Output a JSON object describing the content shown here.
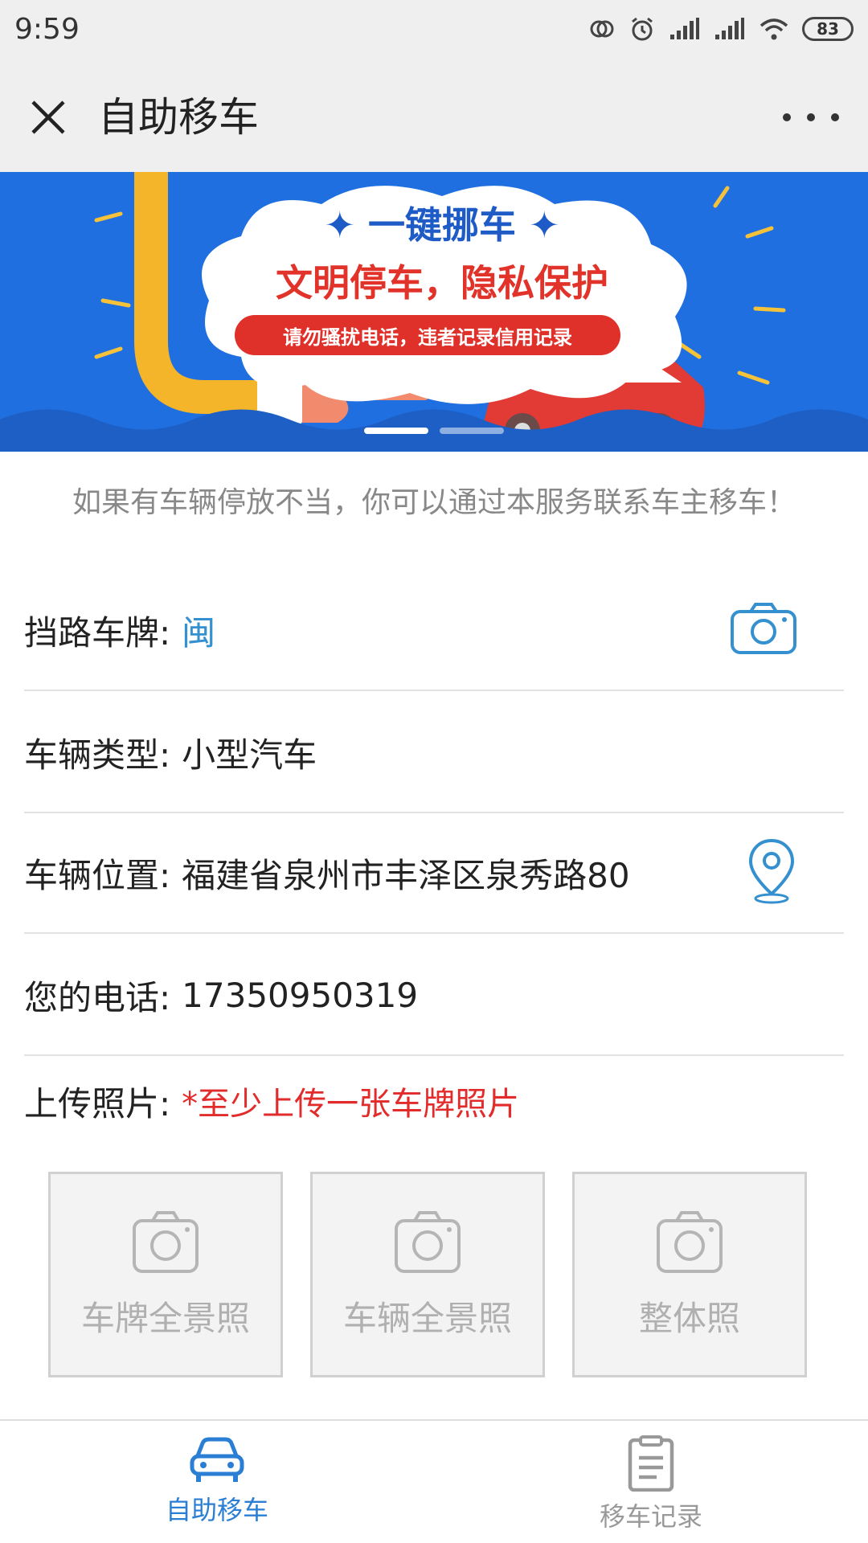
{
  "status_bar": {
    "time": "9:59",
    "battery": "83"
  },
  "header": {
    "title": "自助移车"
  },
  "banner": {
    "title": "✦ 一键挪车 ✦",
    "slogan": "文明停车，隐私保护",
    "subtitle": "请勿骚扰电话，违者记录信用记录"
  },
  "intro": "如果有车辆停放不当，你可以通过本服务联系车主移车！",
  "form": {
    "plate": {
      "label": "挡路车牌:",
      "value": "闽"
    },
    "vehicle_type": {
      "label": "车辆类型:",
      "value": "小型汽车"
    },
    "location": {
      "label": "车辆位置:",
      "value": "福建省泉州市丰泽区泉秀路80"
    },
    "phone": {
      "label": "您的电话:",
      "value": "17350950319"
    },
    "upload": {
      "label": "上传照片:",
      "hint": "*至少上传一张车牌照片"
    }
  },
  "upload_slots": [
    "车牌全景照",
    "车辆全景照",
    "整体照"
  ],
  "bottom_nav": [
    {
      "label": "自助移车",
      "active": true
    },
    {
      "label": "移车记录",
      "active": false
    }
  ],
  "colors": {
    "accent": "#2a7fd4",
    "banner": "#1f6fe0",
    "warning": "#e22b2b"
  }
}
